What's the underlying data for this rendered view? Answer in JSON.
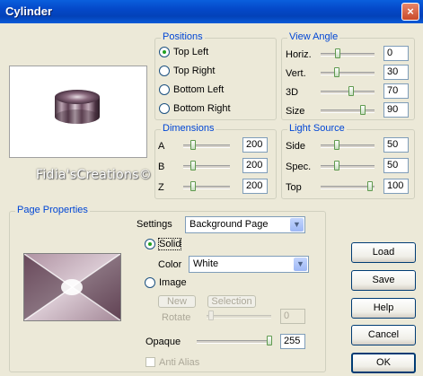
{
  "window": {
    "title": "Cylinder",
    "close_glyph": "×"
  },
  "watermark": "Fidia'sCreations©",
  "positions": {
    "title": "Positions",
    "options": [
      {
        "label": "Top Left",
        "selected": true
      },
      {
        "label": "Top Right",
        "selected": false
      },
      {
        "label": "Bottom Left",
        "selected": false
      },
      {
        "label": "Bottom Right",
        "selected": false
      }
    ]
  },
  "view_angle": {
    "title": "View Angle",
    "rows": [
      {
        "label": "Horiz.",
        "value": "0",
        "level": 0.3
      },
      {
        "label": "Vert.",
        "value": "30",
        "level": 0.28
      },
      {
        "label": "3D",
        "value": "70",
        "level": 0.58
      },
      {
        "label": "Size",
        "value": "90",
        "level": 0.82
      }
    ]
  },
  "dimensions": {
    "title": "Dimensions",
    "rows": [
      {
        "label": "A",
        "value": "200",
        "level": 0.18
      },
      {
        "label": "B",
        "value": "200",
        "level": 0.18
      },
      {
        "label": "Z",
        "value": "200",
        "level": 0.18
      }
    ]
  },
  "light_source": {
    "title": "Light Source",
    "rows": [
      {
        "label": "Side",
        "value": "50",
        "level": 0.28
      },
      {
        "label": "Spec.",
        "value": "50",
        "level": 0.28
      },
      {
        "label": "Top",
        "value": "100",
        "level": 0.96
      }
    ]
  },
  "page_properties": {
    "title": "Page Properties",
    "settings_label": "Settings",
    "settings_value": "Background Page",
    "solid_label": "Solid",
    "solid_selected": true,
    "color_label": "Color",
    "color_value": "White",
    "image_label": "Image",
    "image_selected": false,
    "new_label": "New",
    "selection_label": "Selection",
    "rotate_label": "Rotate",
    "rotate_value": "0",
    "opaque_label": "Opaque",
    "opaque_value": "255",
    "opaque_level": 1.0,
    "anti_alias_label": "Anti Alias"
  },
  "buttons": {
    "load": "Load",
    "save": "Save",
    "help": "Help",
    "cancel": "Cancel",
    "ok": "OK"
  },
  "colors": {
    "title_bar": "#0448c8",
    "group_title": "#0046d5",
    "window_bg": "#ece9d8",
    "cylinder": "#7a5a6e"
  }
}
